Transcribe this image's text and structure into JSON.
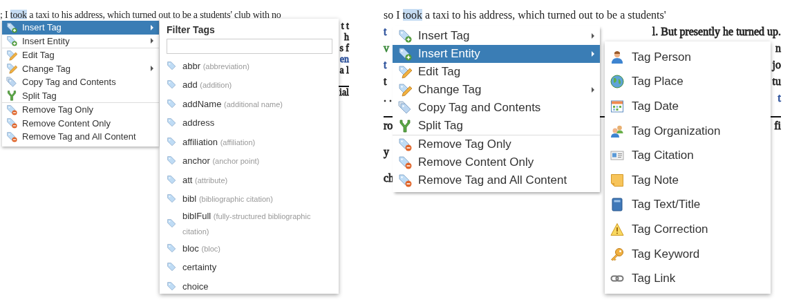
{
  "left_view": {
    "document": [
      {
        "kind": "text",
        "segments": [
          {
            "text": "; I ",
            "highlighted": false
          },
          {
            "text": "took",
            "highlighted": true
          },
          {
            "text": " a taxi to his address, which turned out to be a students' club with no",
            "highlighted": false
          }
        ]
      },
      {
        "kind": "edges",
        "right": {
          "text": "t t",
          "color": "#222222"
        }
      },
      {
        "kind": "edges",
        "right": {
          "text": "h",
          "color": "#222222"
        }
      },
      {
        "kind": "edges",
        "right": {
          "text": "s f",
          "color": "#222222"
        }
      },
      {
        "kind": "edges",
        "right": {
          "text": "en",
          "color": "#2a4f9a"
        }
      },
      {
        "kind": "edges",
        "right": {
          "text": "a l",
          "color": "#222222"
        }
      },
      {
        "kind": "gap"
      },
      {
        "kind": "rule"
      },
      {
        "kind": "edges",
        "right": {
          "text": "ial",
          "color": "#222222"
        }
      }
    ],
    "context_menu": {
      "items": [
        {
          "label": "Insert Tag",
          "kind": "insert",
          "has_submenu": true,
          "selected": true,
          "separator_before": false
        },
        {
          "label": "Insert Entity",
          "kind": "insert",
          "has_submenu": true,
          "selected": false,
          "separator_before": false
        },
        {
          "label": "Edit Tag",
          "kind": "edit",
          "has_submenu": false,
          "selected": false,
          "separator_before": true
        },
        {
          "label": "Change Tag",
          "kind": "edit",
          "has_submenu": true,
          "selected": false,
          "separator_before": false
        },
        {
          "label": "Copy Tag and Contents",
          "kind": "copy",
          "has_submenu": false,
          "selected": false,
          "separator_before": false
        },
        {
          "label": "Split Tag",
          "kind": "split",
          "has_submenu": false,
          "selected": false,
          "separator_before": false
        },
        {
          "label": "Remove Tag Only",
          "kind": "remove",
          "has_submenu": false,
          "selected": false,
          "separator_before": true
        },
        {
          "label": "Remove Content Only",
          "kind": "remove",
          "has_submenu": false,
          "selected": false,
          "separator_before": false
        },
        {
          "label": "Remove Tag and All Content",
          "kind": "remove",
          "has_submenu": false,
          "selected": false,
          "separator_before": false
        }
      ]
    },
    "filter_panel": {
      "title": "Filter Tags",
      "tags": [
        {
          "name": "abbr",
          "description": "(abbreviation)"
        },
        {
          "name": "add",
          "description": "(addition)"
        },
        {
          "name": "addName",
          "description": "(additional name)"
        },
        {
          "name": "address"
        },
        {
          "name": "affiliation",
          "description": "(affiliation)"
        },
        {
          "name": "anchor",
          "description": "(anchor point)"
        },
        {
          "name": "att",
          "description": "(attribute)"
        },
        {
          "name": "bibl",
          "description": "(bibliographic citation)"
        },
        {
          "name": "biblFull",
          "description": "(fully-structured bibliographic citation)"
        },
        {
          "name": "bloc",
          "description": "(bloc)"
        },
        {
          "name": "certainty"
        },
        {
          "name": "choice"
        }
      ]
    }
  },
  "right_view": {
    "document": [
      {
        "kind": "text",
        "segments": [
          {
            "text": "so I ",
            "highlighted": false
          },
          {
            "text": "took",
            "highlighted": true
          },
          {
            "text": " a taxi to his address, which turned out to be a students'",
            "highlighted": false
          }
        ]
      },
      {
        "kind": "edges",
        "left": {
          "text": "t",
          "color": "#2a4f9a"
        },
        "right": {
          "text": "l. But presently he turned up.",
          "color": "#222222"
        }
      },
      {
        "kind": "edges",
        "left": {
          "text": "v",
          "color": "#3c8a3c"
        },
        "right": {
          "text": "n",
          "color": "#222222"
        }
      },
      {
        "kind": "edges",
        "left": {
          "text": "t",
          "color": "#2a4f9a"
        },
        "right": {
          "text": "jo",
          "color": "#222222"
        }
      },
      {
        "kind": "edges",
        "left": {
          "text": "t",
          "color": "#222222"
        },
        "right": {
          "text": "tu",
          "color": "#222222"
        }
      },
      {
        "kind": "edges",
        "left": {
          "text": ". .",
          "color": "#222222"
        },
        "right": {
          "text": "t",
          "color": "#2a4f9a"
        }
      },
      {
        "kind": "gap"
      },
      {
        "kind": "rule"
      },
      {
        "kind": "edges",
        "left": {
          "text": "ro",
          "color": "#222222"
        },
        "right": {
          "text": "fi",
          "color": "#222222"
        }
      },
      {
        "kind": "gap"
      },
      {
        "kind": "edges",
        "left": {
          "text": "y",
          "color": "#222222"
        }
      },
      {
        "kind": "gap"
      },
      {
        "kind": "edges",
        "left": {
          "text": "ch",
          "color": "#222222"
        }
      }
    ],
    "context_menu": {
      "items": [
        {
          "label": "Insert Tag",
          "kind": "insert",
          "has_submenu": true,
          "selected": false,
          "separator_before": false
        },
        {
          "label": "Insert Entity",
          "kind": "insert",
          "has_submenu": true,
          "selected": true,
          "separator_before": false
        },
        {
          "label": "Edit Tag",
          "kind": "edit",
          "has_submenu": false,
          "selected": false,
          "separator_before": false
        },
        {
          "label": "Change Tag",
          "kind": "edit",
          "has_submenu": true,
          "selected": false,
          "separator_before": false
        },
        {
          "label": "Copy Tag and Contents",
          "kind": "copy",
          "has_submenu": false,
          "selected": false,
          "separator_before": false
        },
        {
          "label": "Split Tag",
          "kind": "split",
          "has_submenu": false,
          "selected": false,
          "separator_before": false
        },
        {
          "label": "Remove Tag Only",
          "kind": "remove",
          "has_submenu": false,
          "selected": false,
          "separator_before": true
        },
        {
          "label": "Remove Content Only",
          "kind": "remove",
          "has_submenu": false,
          "selected": false,
          "separator_before": false
        },
        {
          "label": "Remove Tag and All Content",
          "kind": "remove",
          "has_submenu": false,
          "selected": false,
          "separator_before": false
        }
      ]
    },
    "entity_menu": {
      "items": [
        {
          "label": "Tag Person",
          "kind": "person"
        },
        {
          "label": "Tag Place",
          "kind": "place"
        },
        {
          "label": "Tag Date",
          "kind": "date"
        },
        {
          "label": "Tag Organization",
          "kind": "organization"
        },
        {
          "label": "Tag Citation",
          "kind": "citation"
        },
        {
          "label": "Tag Note",
          "kind": "note"
        },
        {
          "label": "Tag Text/Title",
          "kind": "text"
        },
        {
          "label": "Tag Correction",
          "kind": "correction"
        },
        {
          "label": "Tag Keyword",
          "kind": "keyword"
        },
        {
          "label": "Tag Link",
          "kind": "link"
        }
      ]
    }
  }
}
